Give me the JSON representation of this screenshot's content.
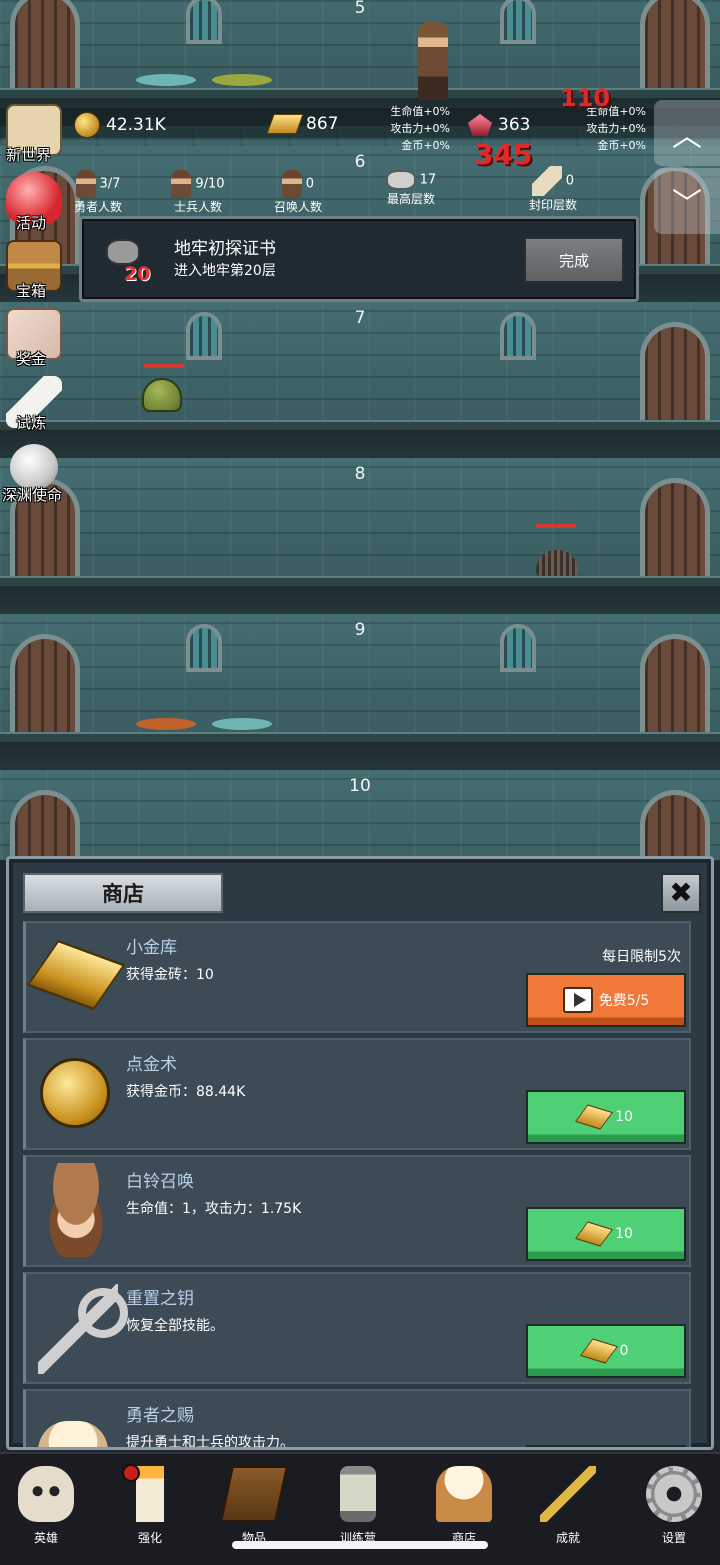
{
  "scene": {
    "floors": [
      "5",
      "6",
      "7",
      "8",
      "9",
      "10"
    ],
    "damage_numbers": [
      "110",
      "345"
    ]
  },
  "hud": {
    "gold": "42.31K",
    "gold_bars": "867",
    "gems": "363",
    "bonus_left": [
      "生命值+0%",
      "攻击力+0%",
      "金币+0%"
    ],
    "bonus_right": [
      "生命值+0%",
      "攻击力+0%",
      "金币+0%"
    ],
    "stats": [
      {
        "value": "3/7",
        "label": "勇者人数"
      },
      {
        "value": "9/10",
        "label": "士兵人数"
      },
      {
        "value": "0",
        "label": "召唤人数"
      },
      {
        "value": "17",
        "label": "最高层数"
      },
      {
        "value": "0",
        "label": "封印层数"
      }
    ],
    "scroll_up": "︿",
    "scroll_down": "﹀"
  },
  "side_menu": [
    {
      "label": "新世界",
      "icon": "map-icon"
    },
    {
      "label": "活动",
      "icon": "heart-icon"
    },
    {
      "label": "宝箱",
      "icon": "chest-icon"
    },
    {
      "label": "奖金",
      "icon": "envelope-icon"
    },
    {
      "label": "试炼",
      "icon": "quill-icon"
    },
    {
      "label": "深渊使命",
      "icon": "orb-icon"
    }
  ],
  "toast": {
    "badge_number": "20",
    "title": "地牢初探证书",
    "subtitle": "进入地牢第20层",
    "button": "完成"
  },
  "shop": {
    "title": "商店",
    "close": "✖",
    "items": [
      {
        "name": "小金库",
        "desc": "获得金砖：10",
        "limit": "每日限制5次",
        "button": "免费5/5",
        "button_style": "orange",
        "icon": "gold-bar-icon"
      },
      {
        "name": "点金术",
        "desc": "获得金币：88.44K",
        "button": "10",
        "button_style": "green",
        "icon": "gold-coin-icon"
      },
      {
        "name": "白铃召唤",
        "desc": "生命值：1，攻击力：1.75K",
        "button": "10",
        "button_style": "green",
        "icon": "girl-portrait-icon"
      },
      {
        "name": "重置之钥",
        "desc": "恢复全部技能。",
        "button": "0",
        "button_style": "green",
        "icon": "key-icon"
      },
      {
        "name": "勇者之赐",
        "desc": "提升勇士和士兵的攻击力。",
        "button": "",
        "button_style": "green",
        "icon": "mug-icon"
      }
    ]
  },
  "nav": [
    {
      "label": "英雄",
      "icon": "skull-icon"
    },
    {
      "label": "强化",
      "icon": "candle-icon"
    },
    {
      "label": "物品",
      "icon": "book-icon"
    },
    {
      "label": "训练营",
      "icon": "lantern-icon"
    },
    {
      "label": "商店",
      "icon": "beer-mug-icon"
    },
    {
      "label": "成就",
      "icon": "key-icon"
    },
    {
      "label": "设置",
      "icon": "gear-icon"
    }
  ],
  "colors": {
    "wall": "#3e6468",
    "shop_bg": "#2c3a44",
    "green_button": "#4fcf76",
    "orange_button": "#f07838",
    "item_name": "#b9d1e8",
    "damage": "#e02a2a"
  }
}
